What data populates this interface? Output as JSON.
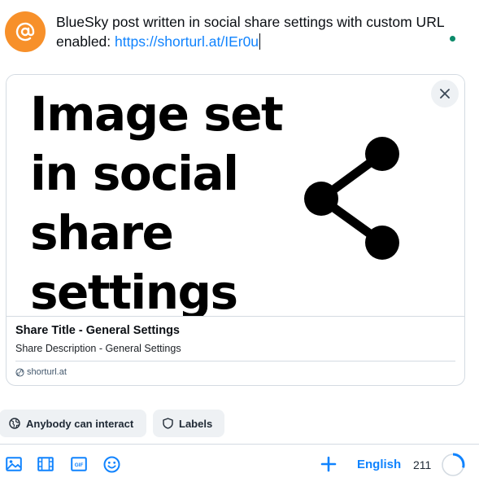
{
  "composer": {
    "post_text": "BlueSky post written in social share settings with custom URL enabled: ",
    "post_link": "https://shorturl.at/IEr0u"
  },
  "card": {
    "image_text": "Image set\nin social\nshare\nsettings",
    "title": "Share Title - General Settings",
    "description": "Share Description - General Settings",
    "domain": "shorturl.at"
  },
  "interaction": {
    "anybody_label": "Anybody can interact",
    "labels_label": "Labels"
  },
  "toolbar": {
    "language": "English",
    "char_count": "211",
    "char_progress": 0.29
  },
  "colors": {
    "accent": "#1083fe",
    "avatar": "#f7902a",
    "status_dot": "#0c8a6a"
  },
  "icons": [
    "at-icon",
    "close-icon",
    "share-icon",
    "link-icon",
    "earth-icon",
    "shield-icon",
    "image-icon",
    "video-icon",
    "gif-icon",
    "emoji-icon",
    "plus-icon"
  ]
}
